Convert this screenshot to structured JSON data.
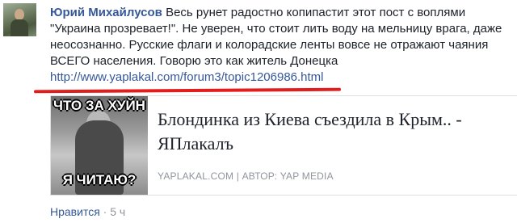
{
  "comment": {
    "author": "Юрий Михайлусов",
    "text": "Весь рунет радостно копипастит этот пост с воплями \"Украина прозревает!\". Не уверен, что стоит лить воду на мельницу врага, даже неосознанно. Русские флаги и колорадские ленты вовсе не отражают чаяния ВСЕГО населения. Говорю это как житель Донецка",
    "link": "http://www.yaplakal.com/forum3/topic1206986.html",
    "underline_color": "#e31c1c"
  },
  "preview": {
    "title": "Блондинка из Киева съездила в Крым.. - ЯПлакалъ",
    "meta": "YAPLAKAL.COM | АВТОР: YAP MEDIA",
    "image_top_text": "ЧТО ЗА ХУЙН",
    "image_bottom_text": "Я ЧИТАЮ?"
  },
  "actions": {
    "like": "Нравится",
    "separator": "·",
    "time": "5 ч"
  },
  "colors": {
    "link": "#365899",
    "text": "#1d2129",
    "muted": "#90949c"
  }
}
